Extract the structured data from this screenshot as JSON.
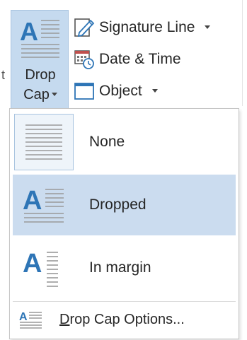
{
  "ribbon": {
    "cut_char": "t",
    "drop_cap_button": {
      "label_line1": "Drop",
      "label_line2": "Cap",
      "icon": "drop-cap-icon"
    },
    "commands": [
      {
        "label": "Signature Line",
        "icon": "signature-line-icon",
        "has_dropdown": true
      },
      {
        "label": "Date & Time",
        "icon": "date-time-icon",
        "has_dropdown": false
      },
      {
        "label": "Object",
        "icon": "object-icon",
        "has_dropdown": true
      }
    ]
  },
  "menu": {
    "items": [
      {
        "label": "None",
        "icon": "drop-cap-none-icon",
        "selected": false
      },
      {
        "label": "Dropped",
        "icon": "drop-cap-dropped-icon",
        "selected": true
      },
      {
        "label": "In margin",
        "icon": "drop-cap-in-margin-icon",
        "selected": false
      }
    ],
    "options": {
      "label_accel": "D",
      "label_rest": "rop Cap Options...",
      "icon": "drop-cap-options-icon"
    }
  },
  "colors": {
    "accent_blue": "#2e75b6",
    "selected_bg": "#cbdcef",
    "button_bg": "#c5daef"
  }
}
